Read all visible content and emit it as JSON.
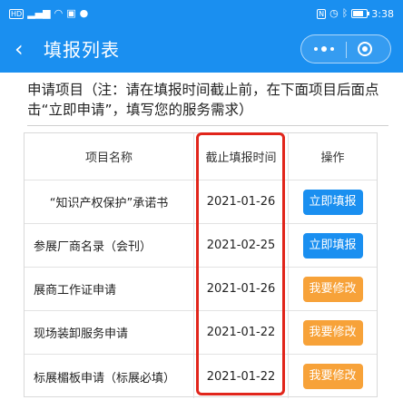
{
  "status_bar": {
    "left_icons": [
      "sim-icon",
      "signal-icon",
      "wifi-icon",
      "message-icon",
      "notification-icon"
    ],
    "right_icons": [
      "nfc-icon",
      "alarm-icon",
      "bluetooth-icon",
      "battery-icon"
    ],
    "time": "3:38"
  },
  "nav": {
    "back_icon": "‹",
    "title": "填报列表"
  },
  "intro": "申请项目（注：请在填报时间截止前，在下面项目后面点击“立即申请”，填写您的服务需求）",
  "table": {
    "headers": {
      "name": "项目名称",
      "deadline": "截止填报时间",
      "action": "操作"
    },
    "rows": [
      {
        "name": "“知识产权保护”承诺书",
        "deadline": "2021-01-26",
        "action": "立即填报",
        "action_type": "fill"
      },
      {
        "name": "参展厂商名录（会刊）",
        "deadline": "2021-02-25",
        "action": "立即填报",
        "action_type": "fill"
      },
      {
        "name": "展商工作证申请",
        "deadline": "2021-01-26",
        "action": "我要修改",
        "action_type": "edit"
      },
      {
        "name": "现场装卸服务申请",
        "deadline": "2021-01-22",
        "action": "我要修改",
        "action_type": "edit"
      },
      {
        "name": "标展楣板申请（标展必填）",
        "deadline": "2021-01-22",
        "action": "我要修改",
        "action_type": "edit"
      }
    ]
  },
  "colors": {
    "brand": "#1a8ff0",
    "fill_button": "#1a8ff0",
    "edit_button": "#f7a239",
    "highlight_border": "#e1251b"
  }
}
